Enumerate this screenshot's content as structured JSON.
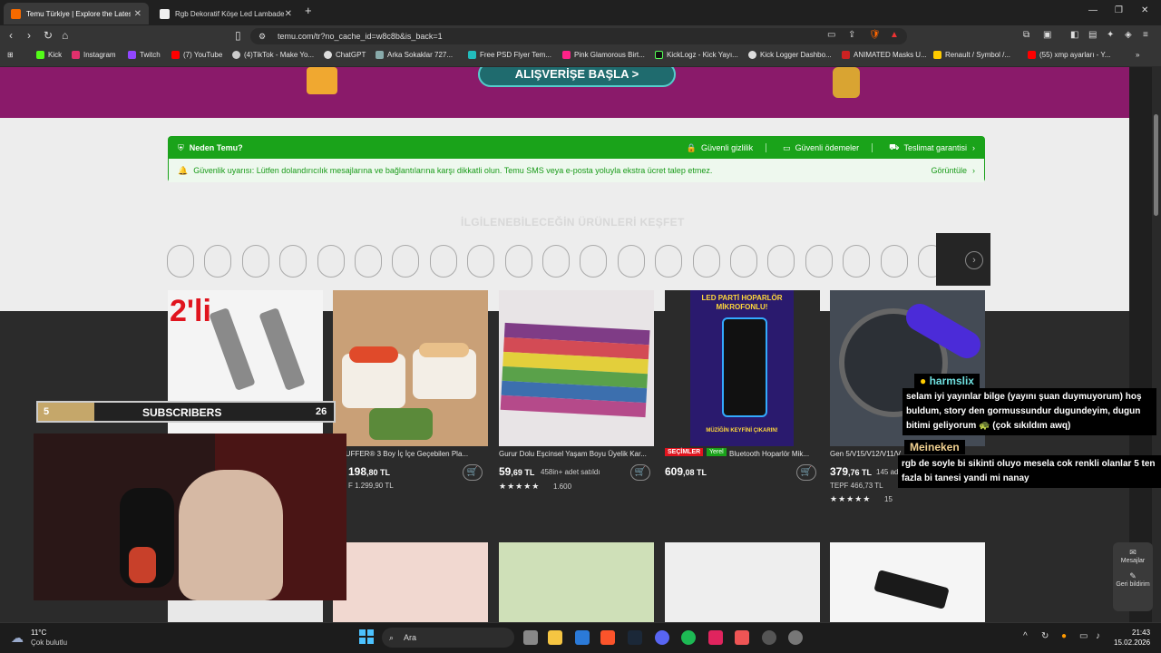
{
  "tabs": [
    {
      "title": "Temu Türkiye | Explore the Lates",
      "active": true
    },
    {
      "title": "Rgb Dekoratif Köşe Led Lambader İşı",
      "active": false
    }
  ],
  "address": {
    "url": "temu.com/tr?no_cache_id=w8c8b&is_back=1"
  },
  "bookmarks": [
    {
      "label": "Kick",
      "color": "#53fc18"
    },
    {
      "label": "Instagram",
      "color": "#e1306c"
    },
    {
      "label": "Twitch",
      "color": "#9146ff"
    },
    {
      "label": "(7) YouTube",
      "color": "#ff0000"
    },
    {
      "label": "(4)TikTok - Make Yo...",
      "color": "#cccccc"
    },
    {
      "label": "ChatGPT",
      "color": "#dddddd"
    },
    {
      "label": "Arka Sokaklar 727...",
      "color": "#8aa"
    },
    {
      "label": "Free PSD Flyer Tem...",
      "color": "#2bb"
    },
    {
      "label": "Pink Glamorous Birt...",
      "color": "#f28"
    },
    {
      "label": "KickLogz - Kick Yayı...",
      "color": "#222"
    },
    {
      "label": "Kick Logger Dashbo...",
      "color": "#ddd"
    },
    {
      "label": "ANIMATED Masks U...",
      "color": "#c22"
    },
    {
      "label": "Renault / Symbol /...",
      "color": "#fc0"
    },
    {
      "label": "(55) xmp ayarları - Y...",
      "color": "#ff0000"
    }
  ],
  "banner": {
    "button": "ALIŞVERİŞE BAŞLA >"
  },
  "trust": {
    "title": "Neden Temu?",
    "items": [
      "Güvenli gizlilik",
      "Güvenli ödemeler",
      "Teslimat garantisi"
    ],
    "warning": "Güvenlik uyarısı: Lütfen dolandırıcılık mesajlarına ve bağlantılarına karşı dikkatli olun. Temu SMS veya e-posta yoluyla ekstra ücret talep etmez.",
    "view": "Görüntüle"
  },
  "reco_title": "İLGİLENEBİLECEĞİN ÜRÜNLERİ KEŞFET",
  "products": [
    {
      "badge": "2'li",
      "title": "",
      "price": "",
      "price_dec": "",
      "sub": "",
      "stars": "",
      "rating": ""
    },
    {
      "badge": "",
      "title": "el BUFFER® 3 Boy İç İçe Geçebilen Pla...",
      "price": "198",
      "price_dec": ",80 TL",
      "sub": "F 1.299,90 TL",
      "stars": "",
      "rating": ""
    },
    {
      "badge": "",
      "title": "Gurur Dolu Eşcinsel Yaşam Boyu Üyelik Kar...",
      "price": "59",
      "price_dec": ",69 TL",
      "sub": "458in+ adet satıldı",
      "stars": "★★★★★",
      "rating": "1.600"
    },
    {
      "badge": "SEÇİMLER",
      "badge2": "Yerel",
      "title": "Bluetooth Hoparlör Mik...",
      "price": "609",
      "price_dec": ",08 TL",
      "sub": "",
      "stars": "",
      "rating": "",
      "image_text": [
        "LED PARTİ HOPARLÖR",
        "MİKROFONLU!",
        "MÜZİĞİN KEYFİNİ ÇIKARIN!"
      ]
    },
    {
      "badge": "",
      "title": "Gen 5/V15/V12/V11/V...",
      "price": "379",
      "price_dec": ",76 TL",
      "sub_extra": "145 adet satıldı",
      "sub": "TEPF 466,73 TL",
      "stars": "★★★★★",
      "rating": "15"
    }
  ],
  "side_panel": {
    "messages": "Mesajlar",
    "report": "Geri bildirim"
  },
  "overlay": {
    "sub_label": "SUBSCRIBERS",
    "sub_current": "5",
    "sub_goal": "26",
    "sub_progress": 0.19,
    "chat": [
      {
        "user": "harmslix",
        "text": "selam iyi yayınlar bilge (yayını şuan duymuyorum) hoş buldum, story den gormussundur dugundeyim, dugun bitimi geliyorum 🐢 (çok sıkıldım awq)"
      },
      {
        "user": "Meineken",
        "text": "rgb de soyle bi sikinti oluyo mesela cok renkli olanlar 5 ten fazla bi tanesi yandi mi nanay"
      }
    ]
  },
  "taskbar": {
    "weather_temp": "11°C",
    "weather_desc": "Çok bulutlu",
    "search": "Ara",
    "time": "21:43",
    "date": "15.02.2026"
  }
}
